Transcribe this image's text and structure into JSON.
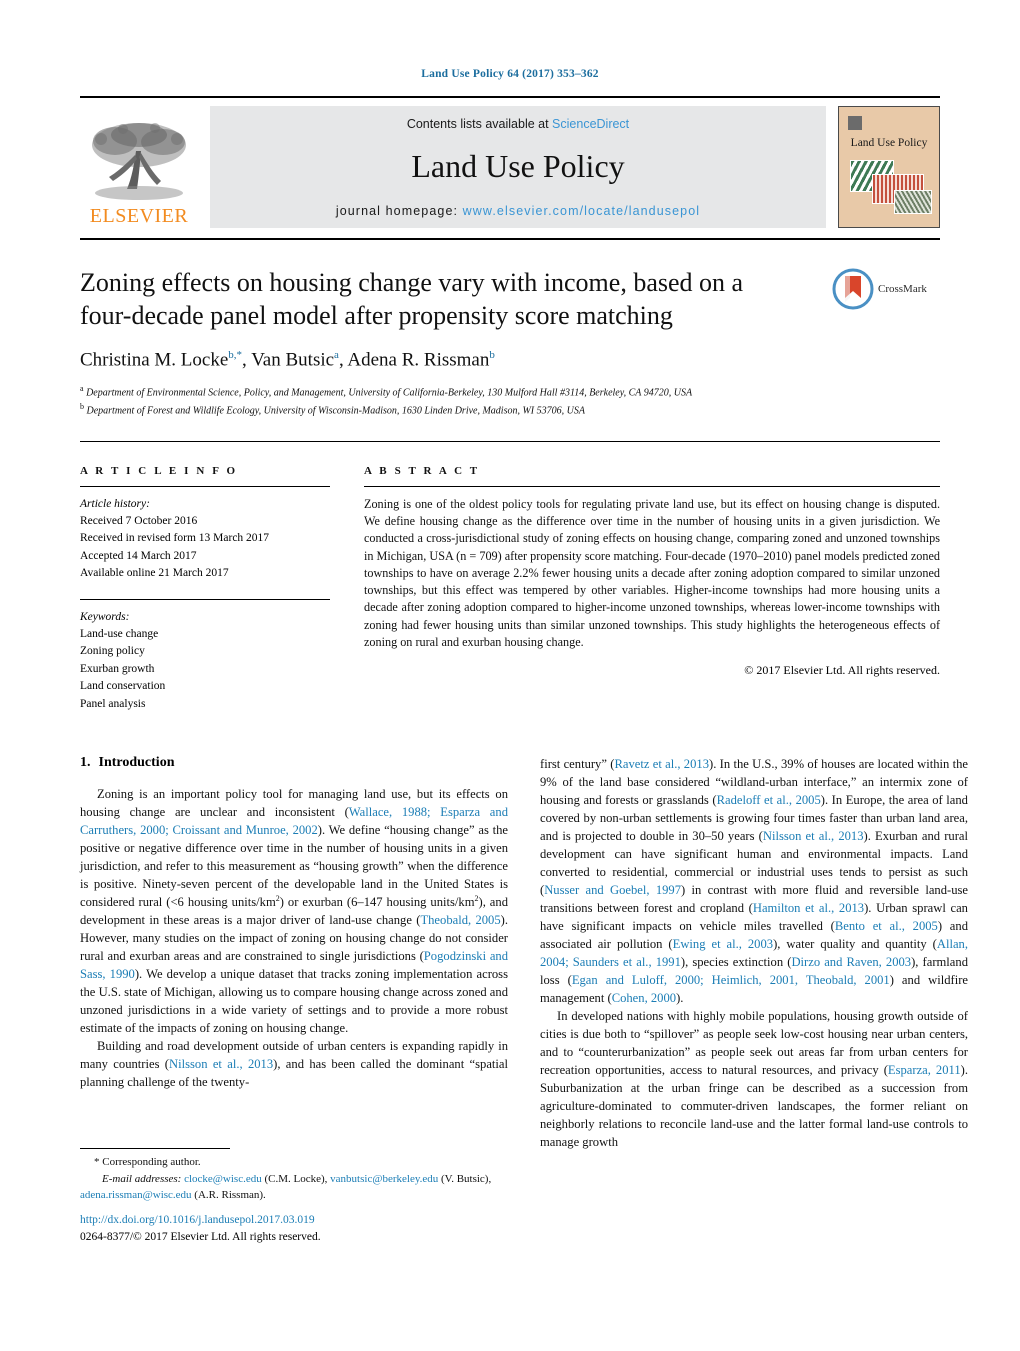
{
  "running_head": "Land Use Policy 64 (2017) 353–362",
  "banner": {
    "publisher_name": "ELSEVIER",
    "contents_prefix": "Contents lists available at ",
    "contents_link": "ScienceDirect",
    "journal_title": "Land Use Policy",
    "homepage_prefix": "journal homepage: ",
    "homepage_url": "www.elsevier.com/locate/landusepol",
    "cover_title": "Land Use Policy"
  },
  "title": "Zoning effects on housing change vary with income, based on a four-decade panel model after propensity score matching",
  "crossmark_label": "CrossMark",
  "authors_html": "Christina M. Locke<sup>b,*</sup>, Van Butsic<sup>a</sup>, Adena R. Rissman<sup>b</sup>",
  "affiliations": [
    "a Department of Environmental Science, Policy, and Management, University of California-Berkeley, 130 Mulford Hall #3114, Berkeley, CA 94720, USA",
    "b Department of Forest and Wildlife Ecology, University of Wisconsin-Madison, 1630 Linden Drive, Madison, WI 53706, USA"
  ],
  "article_info": {
    "heading": "A R T I C L E    I N F O",
    "history_label": "Article history:",
    "history": [
      "Received 7 October 2016",
      "Received in revised form 13 March 2017",
      "Accepted 14 March 2017",
      "Available online 21 March 2017"
    ],
    "keywords_label": "Keywords:",
    "keywords": [
      "Land-use change",
      "Zoning policy",
      "Exurban growth",
      "Land conservation",
      "Panel analysis"
    ]
  },
  "abstract": {
    "heading": "A B S T R A C T",
    "text": "Zoning is one of the oldest policy tools for regulating private land use, but its effect on housing change is disputed. We define housing change as the difference over time in the number of housing units in a given jurisdiction. We conducted a cross-jurisdictional study of zoning effects on housing change, comparing zoned and unzoned townships in Michigan, USA (n = 709) after propensity score matching. Four-decade (1970–2010) panel models predicted zoned townships to have on average 2.2% fewer housing units a decade after zoning adoption compared to similar unzoned townships, but this effect was tempered by other variables. Higher-income townships had more housing units a decade after zoning adoption compared to higher-income unzoned townships, whereas lower-income townships with zoning had fewer housing units than similar unzoned townships. This study highlights the heterogeneous effects of zoning on rural and exurban housing change.",
    "copyright": "© 2017 Elsevier Ltd. All rights reserved."
  },
  "section": {
    "number": "1.",
    "heading": "Introduction"
  },
  "footnotes": {
    "corresponding": "* Corresponding author.",
    "email_label": "E-mail addresses:",
    "emails": [
      {
        "address": "clocke@wisc.edu",
        "owner": "(C.M. Locke),"
      },
      {
        "address": "vanbutsic@berkeley.edu",
        "owner": "(V. Butsic),"
      },
      {
        "address": "adena.rissman@wisc.edu",
        "owner": "(A.R. Rissman)."
      }
    ],
    "doi": "http://dx.doi.org/10.1016/j.landusepol.2017.03.019",
    "issn_line": "0264-8377/© 2017 Elsevier Ltd. All rights reserved."
  },
  "colors": {
    "link": "#1b7db5",
    "running_head": "#1b6d9e",
    "sciencedirect": "#3a95d4",
    "elsevier_orange": "#f28b20",
    "banner_bg": "#e6e7e8",
    "cover_bg": "#e8c9a8"
  }
}
